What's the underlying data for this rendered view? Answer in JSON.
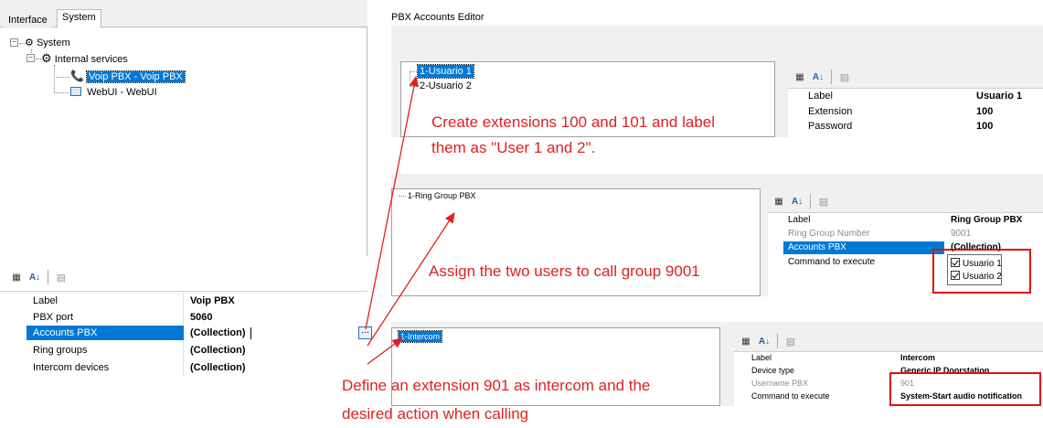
{
  "left_panel": {
    "tabs": [
      {
        "label": "Interface"
      },
      {
        "label": "System"
      }
    ],
    "tree": {
      "root": "System",
      "internal_services": "Internal services",
      "voip": "Voip PBX - Voip PBX",
      "webui": "WebUI - WebUI"
    },
    "props": [
      {
        "label": "Label",
        "value": "Voip PBX"
      },
      {
        "label": "PBX port",
        "value": "5060"
      },
      {
        "label": "Accounts PBX",
        "value": "(Collection)"
      },
      {
        "label": "Ring groups",
        "value": "(Collection)"
      },
      {
        "label": "Intercom devices",
        "value": "(Collection)"
      }
    ],
    "ellipsis": "..."
  },
  "editor": {
    "title": "PBX Accounts Editor",
    "accounts": [
      "1-Usuario 1",
      "2-Usuario 2"
    ],
    "account_props": [
      {
        "label": "Label",
        "value": "Usuario 1"
      },
      {
        "label": "Extension",
        "value": "100"
      },
      {
        "label": "Password",
        "value": "100"
      }
    ],
    "ring_groups": [
      "1-Ring Group PBX"
    ],
    "ring_props": [
      {
        "label": "Label",
        "value": "Ring Group PBX"
      },
      {
        "label": "Ring Group Number",
        "value": "9001"
      },
      {
        "label": "Accounts PBX",
        "value": "(Collection)"
      },
      {
        "label": "Command to execute",
        "value": ""
      }
    ],
    "ring_members": [
      "Usuario 1",
      "Usuario 2"
    ],
    "intercoms": [
      "1-Intercom"
    ],
    "intercom_props": [
      {
        "label": "Label",
        "value": "Intercom"
      },
      {
        "label": "Device type",
        "value": "Generic IP Doorstation"
      },
      {
        "label": "Username PBX",
        "value": "901"
      },
      {
        "label": "Command to execute",
        "value": "System-Start audio notification"
      }
    ]
  },
  "annotations": {
    "a1_line1": "Create extensions 100 and 101 and label",
    "a1_line2": "them as \"User 1 and 2\".",
    "a2": "Assign the two users to call group 9001",
    "a3_line1": "Define an extension 901 as intercom and the",
    "a3_line2": "desired action when calling"
  },
  "colors": {
    "accent": "#0078d7",
    "annotation": "#e02020"
  }
}
